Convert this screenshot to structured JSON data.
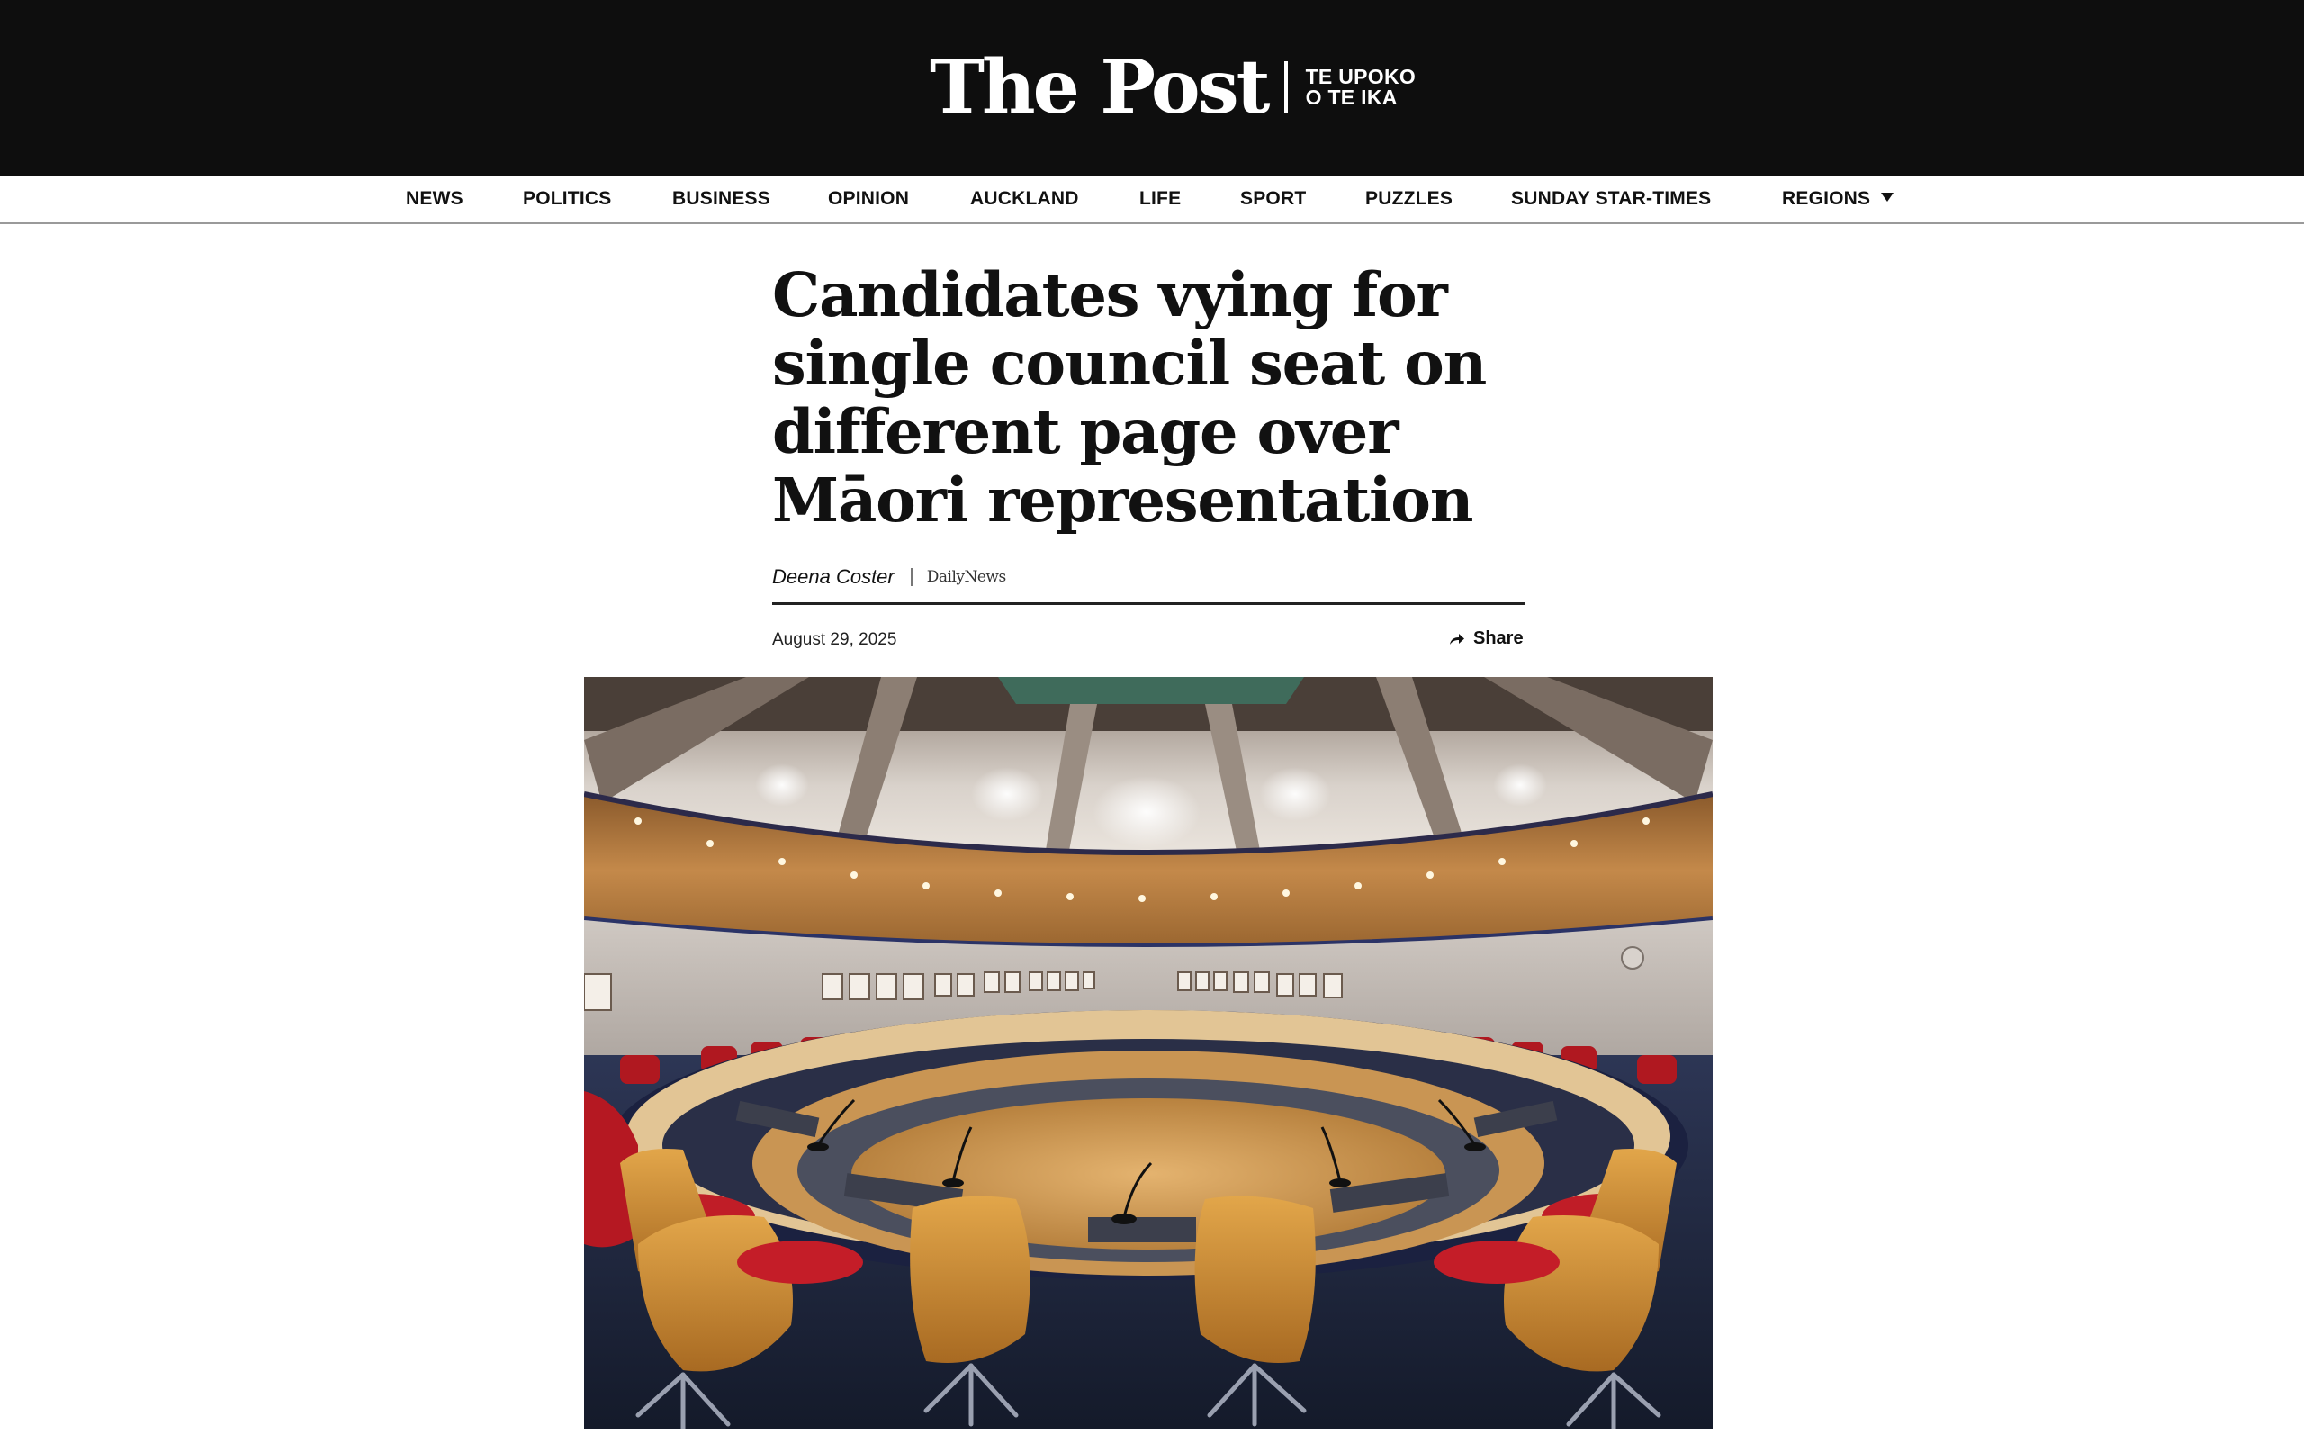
{
  "masthead": {
    "wordmark": "The Post",
    "sub_line1": "TE UPOKO",
    "sub_line2": "O TE IKA"
  },
  "nav": {
    "items": [
      {
        "label": "NEWS"
      },
      {
        "label": "POLITICS"
      },
      {
        "label": "BUSINESS"
      },
      {
        "label": "OPINION"
      },
      {
        "label": "AUCKLAND"
      },
      {
        "label": "LIFE"
      },
      {
        "label": "SPORT"
      },
      {
        "label": "PUZZLES"
      },
      {
        "label": "SUNDAY STAR-TIMES"
      },
      {
        "label": "REGIONS"
      }
    ]
  },
  "article": {
    "headline": "Candidates vying for single council seat on different page over Māori representation",
    "author": "Deena Coster",
    "source": "DailyNews",
    "date": "August 29, 2025",
    "share_label": "Share"
  },
  "icons": {
    "share": "share-arrow-icon",
    "regions_caret": "caret-down-icon"
  },
  "colors": {
    "masthead_bg": "#0e0e0e",
    "nav_border": "#9a9a9a",
    "text": "#111111"
  }
}
